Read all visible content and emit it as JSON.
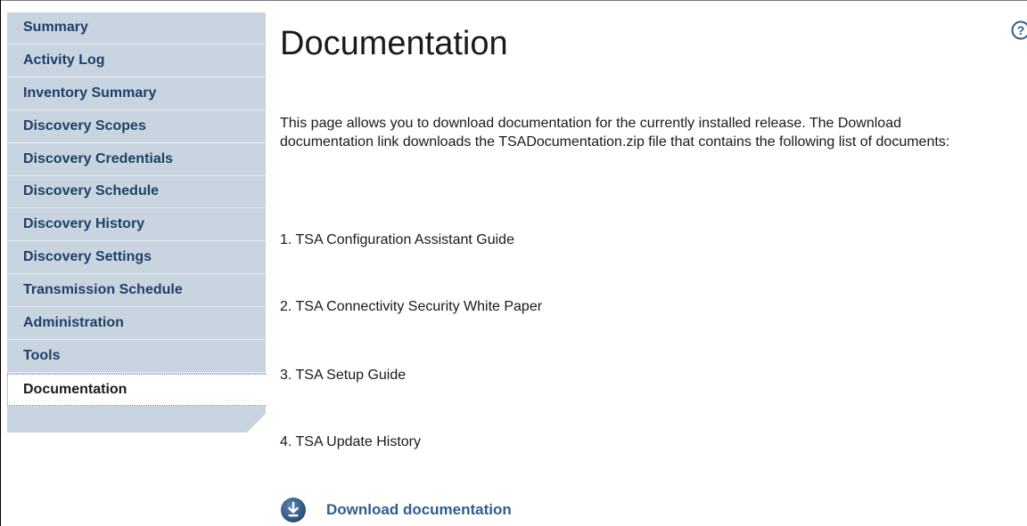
{
  "sidebar": {
    "items": [
      {
        "label": "Summary"
      },
      {
        "label": "Activity Log"
      },
      {
        "label": "Inventory Summary"
      },
      {
        "label": "Discovery Scopes"
      },
      {
        "label": "Discovery Credentials"
      },
      {
        "label": "Discovery Schedule"
      },
      {
        "label": "Discovery History"
      },
      {
        "label": "Discovery Settings"
      },
      {
        "label": "Transmission Schedule"
      },
      {
        "label": "Administration"
      },
      {
        "label": "Tools"
      },
      {
        "label": "Documentation",
        "selected": true
      }
    ]
  },
  "main": {
    "title": "Documentation",
    "intro": "This page allows you to download documentation for the currently installed release. The Download documentation link downloads the TSADocumentation.zip file that contains the following list of documents:",
    "documents": [
      "1. TSA Configuration Assistant Guide",
      "2. TSA Connectivity Security White Paper",
      "3. TSA Setup Guide",
      "4. TSA Update History"
    ],
    "download_label": "Download documentation",
    "download_icon": "download-icon"
  },
  "help": {
    "icon": "help-icon",
    "symbol": "?"
  },
  "colors": {
    "sidebar_bg": "#c8d5e1",
    "sidebar_text": "#1f3f67",
    "link": "#2e5d8e",
    "icon_bg": "#2f5b86"
  }
}
